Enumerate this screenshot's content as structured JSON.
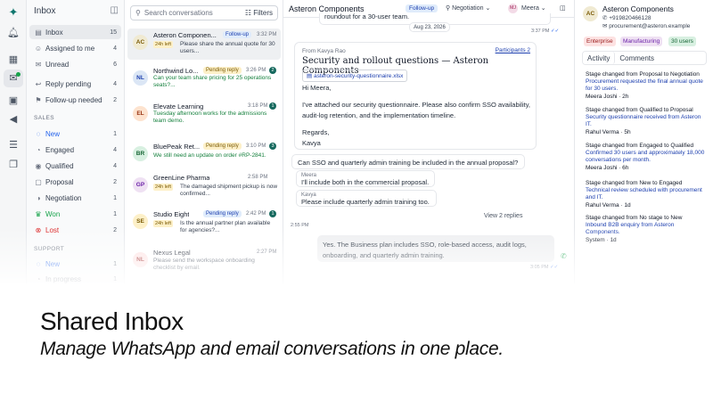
{
  "sidebar": {
    "title": "Inbox",
    "items": [
      {
        "label": "Inbox",
        "count": "15",
        "icon": "inbox-icon"
      },
      {
        "label": "Assigned to me",
        "count": "4",
        "icon": "user-icon"
      },
      {
        "label": "Unread",
        "count": "6",
        "icon": "mail-icon"
      },
      {
        "label": "Reply pending",
        "count": "4",
        "icon": "reply-icon"
      },
      {
        "label": "Follow-up needed",
        "count": "2",
        "icon": "flag-icon"
      }
    ],
    "sales_header": "SALES",
    "sales": [
      {
        "label": "New",
        "count": "1",
        "color": "#2563eb",
        "icon": "circle-icon"
      },
      {
        "label": "Engaged",
        "count": "4",
        "color": "#374151",
        "icon": "chat-icon"
      },
      {
        "label": "Qualified",
        "count": "4",
        "color": "#374151",
        "icon": "check-circle-icon"
      },
      {
        "label": "Proposal",
        "count": "2",
        "color": "#374151",
        "icon": "doc-icon"
      },
      {
        "label": "Negotiation",
        "count": "1",
        "color": "#374151",
        "icon": "handshake-icon"
      },
      {
        "label": "Won",
        "count": "1",
        "color": "#16a34a",
        "icon": "trophy-icon"
      },
      {
        "label": "Lost",
        "count": "2",
        "color": "#dc2626",
        "icon": "x-icon"
      }
    ],
    "support_header": "SUPPORT",
    "support": [
      {
        "label": "New",
        "count": "1"
      },
      {
        "label": "In progress",
        "count": "1"
      }
    ]
  },
  "list": {
    "search_placeholder": "Search conversations",
    "filters_label": "Filters",
    "conversations": [
      {
        "initials": "AC",
        "name": "Asteron Componen...",
        "tag": "Follow-up",
        "time": "3:32 PM",
        "badge": "",
        "left": "24h left",
        "preview": "Please share the annual quote for 30 users...",
        "avatar_bg": "#f0ead2",
        "avatar_fg": "#7a5a04"
      },
      {
        "initials": "NL",
        "name": "Northwind Lo...",
        "tag": "Pending reply",
        "time": "3:26 PM",
        "badge": "2",
        "left": "",
        "preview": "Can your team share pricing for 25 operations seats?...",
        "avatar_bg": "#dbe6f5",
        "avatar_fg": "#1e40af"
      },
      {
        "initials": "EL",
        "name": "Elevate Learning",
        "tag": "",
        "time": "3:18 PM",
        "badge": "1",
        "left": "",
        "preview": "Tuesday afternoon works for the admissions team demo.",
        "avatar_bg": "#fde3cf",
        "avatar_fg": "#9a3412"
      },
      {
        "initials": "BR",
        "name": "BluePeak Ret...",
        "tag": "Pending reply",
        "time": "3:10 PM",
        "badge": "3",
        "left": "",
        "preview": "We still need an update on order #RP-2841.",
        "avatar_bg": "#d8f0e1",
        "avatar_fg": "#166534"
      },
      {
        "initials": "GP",
        "name": "GreenLine Pharma",
        "tag": "",
        "time": "2:58 PM",
        "badge": "",
        "left": "24h left",
        "preview": "The damaged shipment pickup is now confirmed...",
        "avatar_bg": "#efe1f3",
        "avatar_fg": "#6b21a8"
      },
      {
        "initials": "SE",
        "name": "Studio Eight",
        "tag": "Pending reply",
        "time": "2:42 PM",
        "badge": "1",
        "left": "24h left",
        "preview": "Is the annual partner plan available for agencies?...",
        "avatar_bg": "#fdf0c8",
        "avatar_fg": "#7a5a04"
      },
      {
        "initials": "NL",
        "name": "Nexus Legal",
        "tag": "",
        "time": "2:27 PM",
        "badge": "",
        "left": "",
        "preview": "Please send the workspace onboarding checklist by email.",
        "avatar_bg": "#fde2e2",
        "avatar_fg": "#991b1b"
      }
    ]
  },
  "chat": {
    "title": "Asteron Components",
    "status": "Follow-up",
    "stage": "Negotiation",
    "assignee_initials": "MJ",
    "assignee": "Meera",
    "top_bubble": "roundout for a 30-user team.",
    "top_time": "3:37 PM",
    "date": "Aug 23, 2026",
    "email": {
      "from": "From Kavya Rao",
      "participants": "Participants 2",
      "subject": "Security and rollout questions — Asteron Components",
      "attachment": "asteron-security-questionnaire.xlsx",
      "greeting": "Hi Meera,",
      "body1": "I've attached our security questionnaire. Please also confirm SSO availability,",
      "body2": "audit-log retention, and the implementation timeline.",
      "regards": "Regards,",
      "sign": "Kavya"
    },
    "question": "Can SSO and quarterly admin training be included in the annual proposal?",
    "reply1_author": "Meera",
    "reply1": "I'll include both in the commercial proposal.",
    "reply2_author": "Kavya",
    "reply2": "Please include quarterly admin training too.",
    "view_replies": "View 2 replies",
    "q_time": "2:55 PM",
    "out_msg1": "Yes. The Business plan includes SSO, role-based access, audit logs,",
    "out_msg2": "onboarding, and quarterly admin training.",
    "out_time": "3:05 PM"
  },
  "contact": {
    "initials": "AC",
    "name": "Asteron Components",
    "phone": "+919820466128",
    "email": "procurement@asteron.example",
    "chips": [
      {
        "label": "Enterprise",
        "bg": "#fde2e2",
        "fg": "#991b1b"
      },
      {
        "label": "Manufacturing",
        "bg": "#efe1f3",
        "fg": "#6b21a8"
      },
      {
        "label": "30 users",
        "bg": "#d8f0e1",
        "fg": "#166534"
      }
    ],
    "tabs": [
      "Activity",
      "Comments"
    ],
    "activity": [
      {
        "head": "Stage changed from Proposal to Negotiation",
        "detail": "Procurement requested the final annual quote for 30 users.",
        "by": "Meera Joshi · 2h"
      },
      {
        "head": "Stage changed from Qualified to Proposal",
        "detail": "Security questionnaire received from Asteron IT.",
        "by": "Rahul Verma · 5h"
      },
      {
        "head": "Stage changed from Engaged to Qualified",
        "detail": "Confirmed 30 users and approximately 18,000 conversations per month.",
        "by": "Meera Joshi · 6h"
      },
      {
        "head": "Stage changed from New to Engaged",
        "detail": "Technical review scheduled with procurement and IT.",
        "by": "Rahul Verma · 1d"
      },
      {
        "head": "Stage changed from No stage to New",
        "detail": "Inbound B2B enquiry from Asteron Components.",
        "by": "System · 1d"
      }
    ]
  },
  "caption": {
    "title": "Shared Inbox",
    "subtitle": "Manage WhatsApp and email conversations in one place."
  }
}
